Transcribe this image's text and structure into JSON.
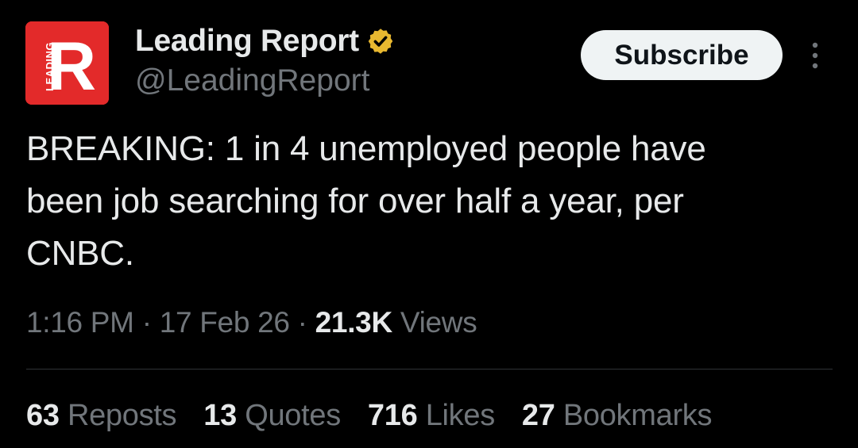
{
  "author": {
    "display_name": "Leading Report",
    "handle": "@LeadingReport",
    "verified": true,
    "avatar": {
      "letter": "R",
      "side_text": "LEADING",
      "background": "#e32a2a"
    }
  },
  "actions": {
    "subscribe_label": "Subscribe",
    "more_icon": "more-vertical-icon"
  },
  "tweet": {
    "text": "BREAKING: 1 in 4 unemployed people have\nbeen job searching for over half a year, per\nCNBC."
  },
  "meta": {
    "time": "1:16 PM",
    "separator": "·",
    "date": "17 Feb 26",
    "views_count": "21.3K",
    "views_label": "Views"
  },
  "stats": [
    {
      "count": "63",
      "label": "Reposts"
    },
    {
      "count": "13",
      "label": "Quotes"
    },
    {
      "count": "716",
      "label": "Likes"
    },
    {
      "count": "27",
      "label": "Bookmarks"
    }
  ],
  "colors": {
    "background": "#000000",
    "primary_text": "#e7e9ea",
    "secondary_text": "#71767b",
    "verified_badge": "#e8b830",
    "divider": "#2f3336",
    "subscribe_bg": "#eff3f4"
  }
}
